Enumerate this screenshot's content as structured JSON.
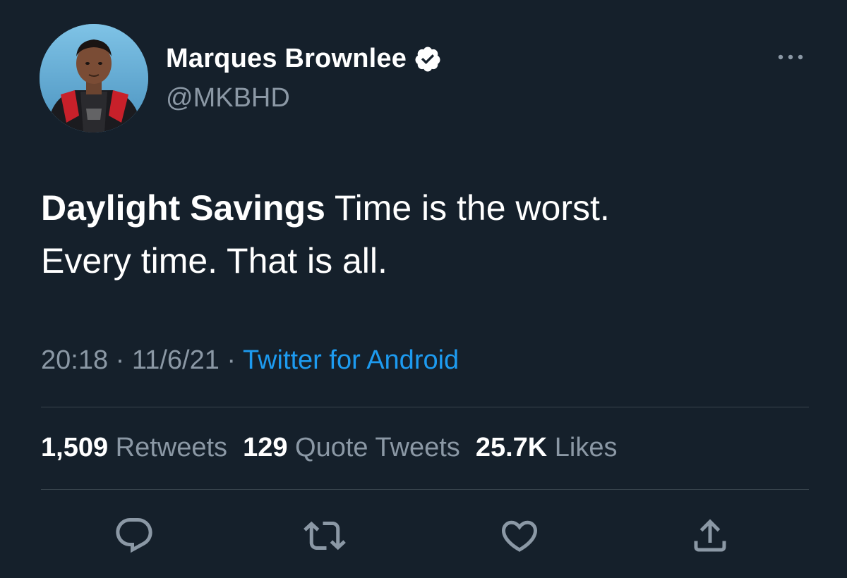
{
  "author": {
    "display_name": "Marques Brownlee",
    "handle": "@MKBHD",
    "avatar_icon": "profile-photo",
    "verified_icon": "verified-badge-icon"
  },
  "tweet": {
    "text_bold": "Daylight Savings",
    "text_rest_line1": " Time is the worst.",
    "text_line2": "Every time. That is all."
  },
  "meta": {
    "time": "20:18",
    "separator1": " · ",
    "date": "11/6/21",
    "separator2": " · ",
    "source": "Twitter for Android"
  },
  "stats": {
    "retweets_count": "1,509",
    "retweets_label": "Retweets",
    "quotes_count": "129",
    "quotes_label": "Quote Tweets",
    "likes_count": "25.7K",
    "likes_label": "Likes"
  },
  "actions": {
    "reply_icon": "reply-icon",
    "retweet_icon": "retweet-icon",
    "like_icon": "heart-icon",
    "share_icon": "share-icon"
  },
  "colors": {
    "background": "#15202b",
    "primary_text": "#ffffff",
    "secondary_text": "#8b98a5",
    "accent": "#1d9bf0",
    "divider": "#38444d"
  }
}
